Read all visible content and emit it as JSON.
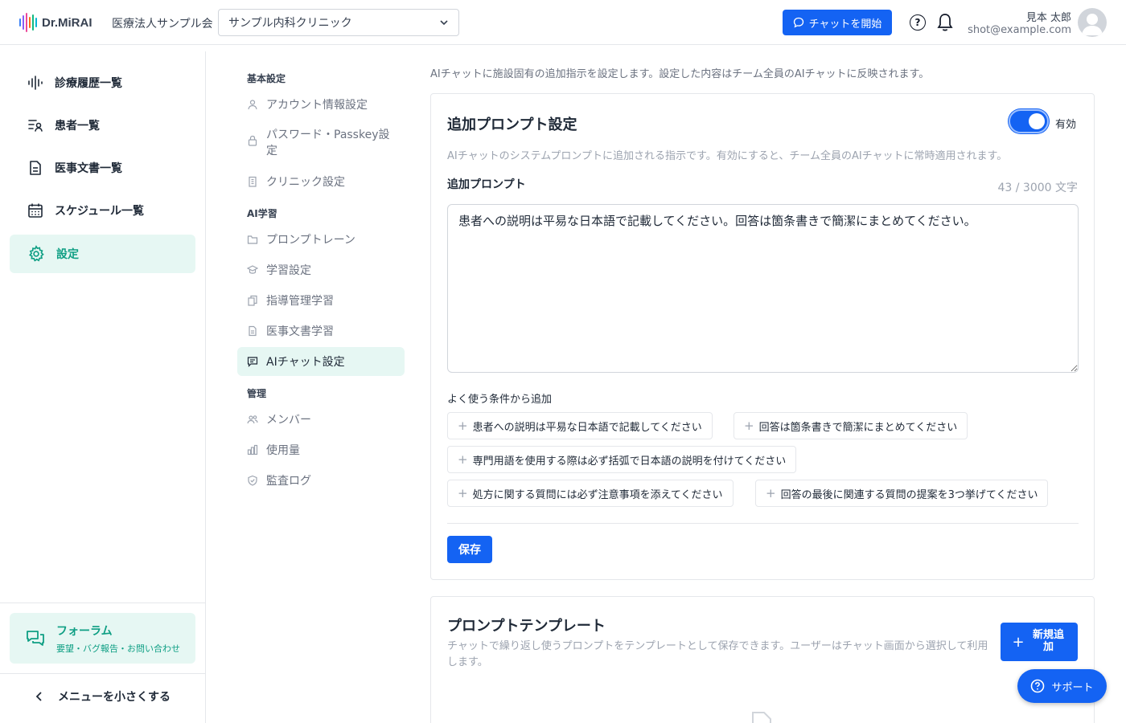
{
  "header": {
    "logo_text": "Dr.MiRAI",
    "org_name": "医療法人サンプル会",
    "clinic_select": "サンプル内科クリニック",
    "chat_button": "チャットを開始",
    "user_name": "見本 太郎",
    "user_email": "shot@example.com"
  },
  "sidebar": {
    "items": [
      {
        "label": "診療履歴一覧",
        "icon": "waveform-icon"
      },
      {
        "label": "患者一覧",
        "icon": "patient-list-icon"
      },
      {
        "label": "医事文書一覧",
        "icon": "document-icon"
      },
      {
        "label": "スケジュール一覧",
        "icon": "calendar-icon"
      },
      {
        "label": "設定",
        "icon": "gear-icon",
        "active": true
      }
    ],
    "forum_title": "フォーラム",
    "forum_sub": "要望・バグ報告・お問い合わせ",
    "collapse_label": "メニューを小さくする"
  },
  "subnav": {
    "section_basic": "基本設定",
    "account": "アカウント情報設定",
    "password": "パスワード・Passkey設定",
    "clinic": "クリニック設定",
    "section_ai": "AI学習",
    "prompt_training": "プロンプトレーン",
    "learning": "学習設定",
    "guidance": "指導管理学習",
    "medical_doc": "医事文書学習",
    "ai_chat": "AIチャット設定",
    "section_admin": "管理",
    "members": "メンバー",
    "usage": "使用量",
    "audit": "監査ログ"
  },
  "main": {
    "intro": "AIチャットに施設固有の追加指示を設定します。設定した内容はチーム全員のAIチャットに反映されます。",
    "prompt_card": {
      "title": "追加プロンプト設定",
      "toggle_label": "有効",
      "toggle_on": true,
      "description": "AIチャットのシステムプロンプトに追加される指示です。有効にすると、チーム全員のAIチャットに常時適用されます。",
      "field_label": "追加プロンプト",
      "char_count": "43 / 3000 文字",
      "prompt_value": "患者への説明は平易な日本語で記載してください。回答は箇条書きで簡潔にまとめてください。",
      "chips_label": "よく使う条件から追加",
      "chips": [
        "患者への説明は平易な日本語で記載してください",
        "回答は箇条書きで簡潔にまとめてください",
        "専門用語を使用する際は必ず括弧で日本語の説明を付けてください",
        "処方に関する質問には必ず注意事項を添えてください",
        "回答の最後に関連する質問の提案を3つ挙げてください"
      ],
      "save_label": "保存"
    },
    "template_card": {
      "title": "プロンプトテンプレート",
      "description": "チャットで繰り返し使うプロンプトをテンプレートとして保存できます。ユーザーはチャット画面から選択して利用します。",
      "new_button": "新規追加"
    }
  },
  "support_button": "サポート",
  "colors": {
    "primary": "#1463f3",
    "accent_green": "#0f9f84",
    "active_bg": "#e6f7f3"
  }
}
